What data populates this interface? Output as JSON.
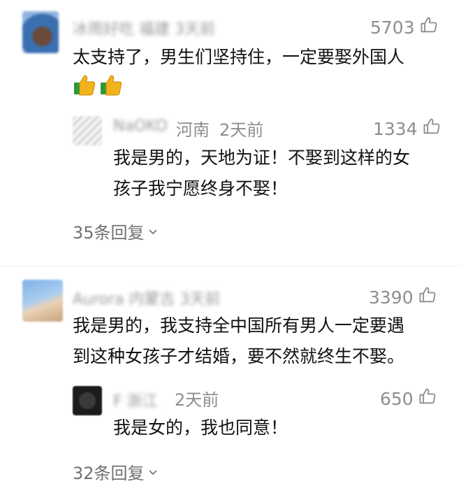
{
  "comments": [
    {
      "user": "冰雨好吃 福建 3天前",
      "likes": "5703",
      "text": "太支持了，男生们坚持住，一定要娶外国人",
      "emoji": [
        "thumbs-up",
        "thumbs-up"
      ],
      "reply": {
        "user": "NaOKO",
        "location": "河南",
        "time": "2天前",
        "likes": "1334",
        "text_line1": "我是男的，天地为证！不娶到这样的女",
        "text_line2": "孩子我宁愿终身不娶！"
      },
      "reply_count": "35条回复"
    },
    {
      "user": "Aurora 内蒙古 3天前",
      "likes": "3390",
      "text_line1": "我是男的，我支持全中国所有男人一定要遇",
      "text_line2": "到这种女孩子才结婚，要不然就终生不娶。",
      "reply": {
        "user": "F 浙江",
        "time": "2天前",
        "likes": "650",
        "text": "我是女的，我也同意！"
      },
      "reply_count": "32条回复"
    }
  ],
  "colors": {
    "meta": "#8e8e8e",
    "text": "#111111",
    "emoji": "#f2b21b"
  }
}
